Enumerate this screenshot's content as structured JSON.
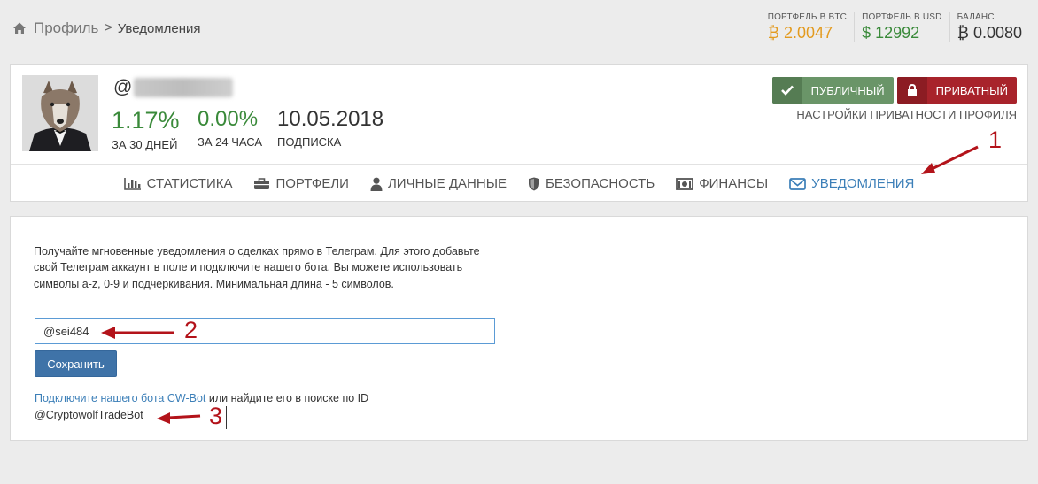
{
  "breadcrumb": {
    "root": "Профиль",
    "separator": ">",
    "current": "Уведомления"
  },
  "stats": [
    {
      "label": "ПОРТФЕЛЬ В BTC",
      "symbol": "₿",
      "value": "2.0047"
    },
    {
      "label": "ПОРТФЕЛЬ В USD",
      "symbol": "$",
      "value": "12992"
    },
    {
      "label": "БАЛАНС",
      "symbol": "₿",
      "value": "0.0080"
    }
  ],
  "profile": {
    "at": "@",
    "metrics": [
      {
        "value": "1.17%",
        "caption": "ЗА 30 ДНЕЙ"
      },
      {
        "value": "0.00%",
        "caption": "ЗА 24 ЧАСА"
      },
      {
        "value": "10.05.2018",
        "caption": "ПОДПИСКА"
      }
    ]
  },
  "privacy": {
    "public_label": "ПУБЛИЧНЫЙ",
    "private_label": "ПРИВАТНЫЙ",
    "caption": "НАСТРОЙКИ ПРИВАТНОСТИ ПРОФИЛЯ"
  },
  "tabs": [
    {
      "label": "СТАТИСТИКА",
      "icon": "bar-chart-icon"
    },
    {
      "label": "ПОРТФЕЛИ",
      "icon": "briefcase-icon"
    },
    {
      "label": "ЛИЧНЫЕ ДАННЫЕ",
      "icon": "user-icon"
    },
    {
      "label": "БЕЗОПАСНОСТЬ",
      "icon": "shield-icon"
    },
    {
      "label": "ФИНАНСЫ",
      "icon": "money-icon"
    },
    {
      "label": "УВЕДОМЛЕНИЯ",
      "icon": "envelope-icon",
      "active": true
    }
  ],
  "notifications": {
    "description": "Получайте мгновенные уведомления о сделках прямо в Телеграм. Для этого добавьте свой Телеграм аккаунт в поле и подключите нашего бота. Вы можете использовать символы a-z, 0-9 и подчеркивания. Минимальная длина - 5 символов.",
    "telegram_value": "@sei484",
    "save_label": "Сохранить",
    "bot_link": "Подключите нашего бота CW-Bot",
    "bot_text": " или найдите его в поиске по ID",
    "bot_id": "@CryptowolfTradeBot"
  },
  "annotations": [
    "1",
    "2",
    "3"
  ],
  "colors": {
    "accent": "#3c7fb8",
    "green": "#3a8a3a",
    "orange": "#e39a1e",
    "public": "#6a9568",
    "private": "#a8232b",
    "annotation": "#b3131a"
  }
}
